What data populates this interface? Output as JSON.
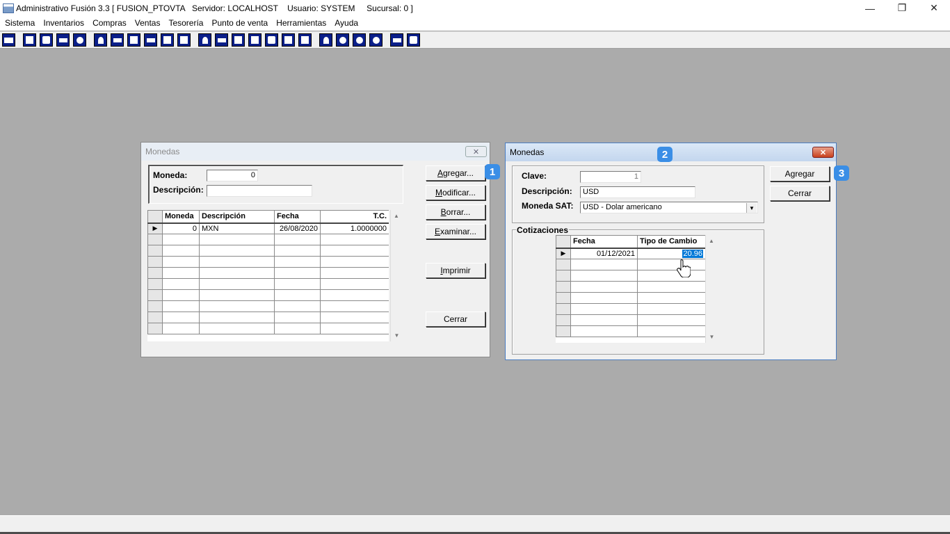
{
  "app": {
    "title": "Administrativo Fusión 3.3 [ FUSION_PTOVTA   Servidor: LOCALHOST    Usuario: SYSTEM     Sucursal: 0 ]",
    "controls": {
      "minimize": "—",
      "restore": "❐",
      "close": "✕"
    }
  },
  "menu": [
    "Sistema",
    "Inventarios",
    "Compras",
    "Ventas",
    "Tesorería",
    "Punto de venta",
    "Herramientas",
    "Ayuda"
  ],
  "dialog_list": {
    "title": "Monedas",
    "close": "✕",
    "moneda_label": "Moneda:",
    "moneda_value": "0",
    "descripcion_label": "Descripción:",
    "descripcion_value": "",
    "columns": [
      "Moneda",
      "Descripción",
      "Fecha",
      "T.C."
    ],
    "rows": [
      {
        "indicator": "▶",
        "moneda": "0",
        "descripcion": "MXN",
        "fecha": "26/08/2020",
        "tc": "1.0000000"
      }
    ],
    "buttons": {
      "agregar": "Agregar...",
      "modificar": "Modificar...",
      "borrar": "Borrar...",
      "examinar": "Examinar...",
      "imprimir": "Imprimir",
      "cerrar": "Cerrar"
    }
  },
  "dialog_edit": {
    "title": "Monedas",
    "close": "✕",
    "clave_label": "Clave:",
    "clave_value": "1",
    "descripcion_label": "Descripción:",
    "descripcion_value": "USD",
    "moneda_sat_label": "Moneda SAT:",
    "moneda_sat_value": "USD - Dolar americano",
    "cotizaciones_label": "Cotizaciones",
    "columns": [
      "Fecha",
      "Tipo de Cambio"
    ],
    "rows": [
      {
        "indicator": "▶",
        "fecha": "01/12/2021",
        "tipo_cambio": "20.96"
      }
    ],
    "buttons": {
      "agregar": "Agregar",
      "cerrar": "Cerrar"
    }
  },
  "badges": [
    "1",
    "2",
    "3"
  ],
  "colors": {
    "badge": "#3a8ee6",
    "selection": "#0078d7",
    "toolbar_icon": "#0b1f8a"
  }
}
